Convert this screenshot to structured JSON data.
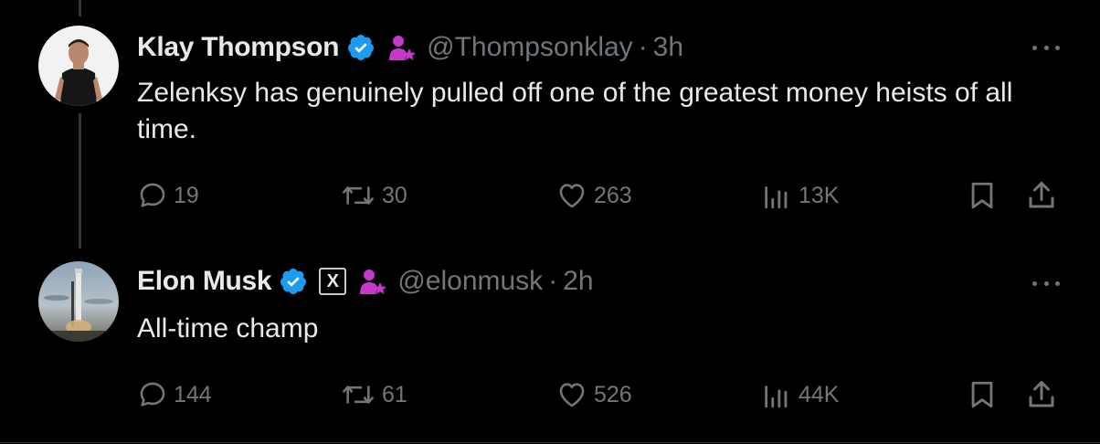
{
  "tweets": [
    {
      "name": "Klay Thompson",
      "handle": "@Thompsonklay",
      "separator": "·",
      "time": "3h",
      "text": "Zelenksy has genuinely pulled off one of the greatest money heists of all time.",
      "replies": "19",
      "reposts": "30",
      "likes": "263",
      "views": "13K",
      "verified_color": "#1d9bf0",
      "affiliate_color": "#c936d0"
    },
    {
      "name": "Elon Musk",
      "handle": "@elonmusk",
      "separator": "·",
      "time": "2h",
      "text": "All-time champ",
      "replies": "144",
      "reposts": "61",
      "likes": "526",
      "views": "44K",
      "org_badge": "X",
      "verified_color": "#1d9bf0",
      "affiliate_color": "#c936d0"
    }
  ],
  "colors": {
    "background": "#000000",
    "text": "#e7e9ea",
    "muted": "#71767b",
    "divider": "#2f3336"
  }
}
